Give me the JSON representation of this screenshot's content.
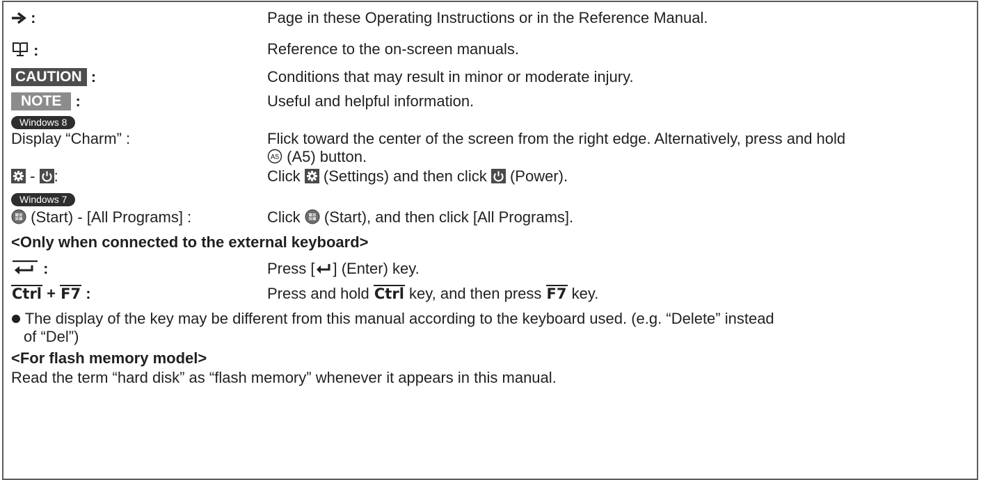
{
  "conventions": {
    "arrow_label": ":",
    "arrow_desc": "Page in these Operating Instructions or in the Reference Manual.",
    "manual_label": ":",
    "manual_desc": "Reference to the on-screen manuals.",
    "caution_badge": "CAUTION",
    "caution_colon": ":",
    "caution_desc": "Conditions that may result in minor or moderate injury.",
    "note_badge": "NOTE",
    "note_colon": ":",
    "note_desc": "Useful and helpful information."
  },
  "windows8": {
    "pill": "Windows 8",
    "charm_label": "Display “Charm” :",
    "charm_desc_line1": "Flick toward the center of the screen from the right edge. Alternatively, press and hold",
    "charm_desc_a5_icon": "A5",
    "charm_desc_line2": "(A5) button.",
    "settings_sep": "-",
    "settings_colon": ":",
    "settings_desc_1": "Click",
    "settings_desc_2": "(Settings) and then click",
    "settings_desc_3": "(Power)."
  },
  "windows7": {
    "pill": "Windows 7",
    "start_label": "(Start) - [All Programs] :",
    "start_desc_1": "Click",
    "start_desc_2": "(Start), and then click [All Programs]."
  },
  "external_keyboard": {
    "heading": "<Only when connected to the external keyboard>",
    "enter_colon": ":",
    "enter_desc_1": "Press [",
    "enter_desc_2": "] (Enter) key.",
    "ctrl_key": "Ctrl",
    "plus": "+",
    "f7_key": "F7",
    "ctrl_colon": ":",
    "ctrl_desc_1": "Press and hold",
    "ctrl_desc_2": "key, and then press",
    "ctrl_desc_3": "key."
  },
  "note_bullet": {
    "line1": "The display of the key may be different from this manual according to the keyboard used. (e.g. “Delete” instead",
    "line2": "of “Del”)"
  },
  "flash": {
    "heading": "<For flash memory model>",
    "text": "Read the term “hard disk” as “flash memory” whenever it appears in this manual."
  },
  "icons": [
    "arrow-right-icon",
    "book-monitor-icon",
    "a5-button-icon",
    "settings-gear-icon",
    "power-icon",
    "windows-start-orb-icon",
    "enter-key-icon",
    "bullet-dot-icon"
  ]
}
